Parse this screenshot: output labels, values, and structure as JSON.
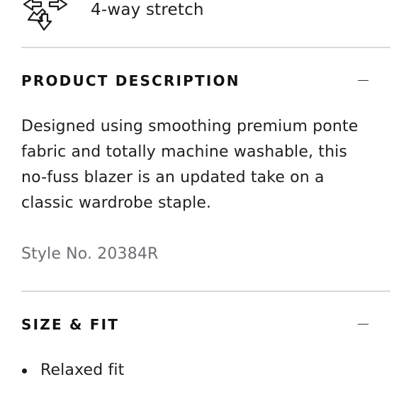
{
  "features": {
    "stretch": {
      "icon": "four-way-stretch-arrows-icon",
      "label": "4-way stretch"
    }
  },
  "product_description": {
    "title": "PRODUCT DESCRIPTION",
    "toggle_icon": "minus-icon",
    "body": "Designed using smoothing premium ponte fabric and totally machine washable, this no-fuss blazer is an updated take on a classic wardrobe staple.",
    "style_number": "Style No. 20384R"
  },
  "size_fit": {
    "title": "SIZE & FIT",
    "toggle_icon": "minus-icon",
    "items": [
      {
        "text": "Relaxed fit"
      }
    ]
  },
  "colors": {
    "text": "#1f1f1f",
    "muted": "#6e6e73",
    "divider": "#d9d9d9"
  }
}
